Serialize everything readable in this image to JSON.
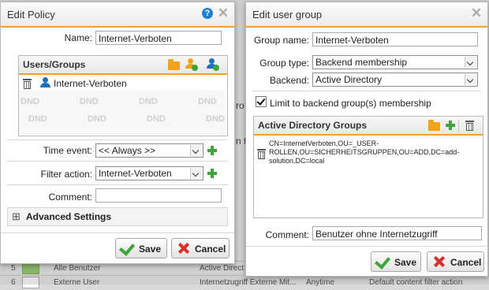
{
  "background": {
    "row1": {
      "num": "5",
      "name": "Alle Benutzer",
      "col": "Active Direct"
    },
    "row2": {
      "num": "6",
      "name": "Externe User",
      "col": "Internetzugriff Externe Mit...",
      "time": "Anytime",
      "filter": "Default content filter action"
    },
    "frag_a": "ro",
    "frag_b": "n t"
  },
  "edit_policy": {
    "title": "Edit Policy",
    "name_label": "Name:",
    "name_value": "Internet-Verboten",
    "users_groups": {
      "title": "Users/Groups",
      "entry": "Internet-Verboten",
      "dnd": [
        "DND",
        "DND",
        "DND",
        "DND",
        "DND",
        "DND",
        "DND",
        "DND",
        "DND",
        "DND"
      ]
    },
    "time_event_label": "Time event:",
    "time_event_value": "<< Always >>",
    "filter_action_label": "Filter action:",
    "filter_action_value": "Internet-Verboten",
    "comment_label": "Comment:",
    "comment_value": "",
    "advanced_label": "Advanced Settings",
    "expand_glyph": "⊞",
    "save_label": "Save",
    "cancel_label": "Cancel"
  },
  "edit_user_group": {
    "title": "Edit user group",
    "group_name_label": "Group name:",
    "group_name_value": "Internet-Verboten",
    "group_type_label": "Group type:",
    "group_type_value": "Backend membership",
    "backend_label": "Backend:",
    "backend_value": "Active Directory",
    "limit_label": "Limit to backend group(s) membership",
    "limit_checked": true,
    "ad_groups": {
      "title": "Active Directory Groups",
      "entry_lines": [
        "CN=InternetVerboten,OU=_USER-",
        "ROLLEN,OU=SICHERHEITSGRUPPEN,OU=ADD,DC=add-",
        "solution,DC=local"
      ]
    },
    "comment_label": "Comment:",
    "comment_value": "Benutzer ohne Internetzugriff",
    "save_label": "Save",
    "cancel_label": "Cancel"
  },
  "colors": {
    "accent": "#f0a22a",
    "plus": "#3da53a",
    "help": "#1f7fd0",
    "cancel": "#d9302a"
  }
}
